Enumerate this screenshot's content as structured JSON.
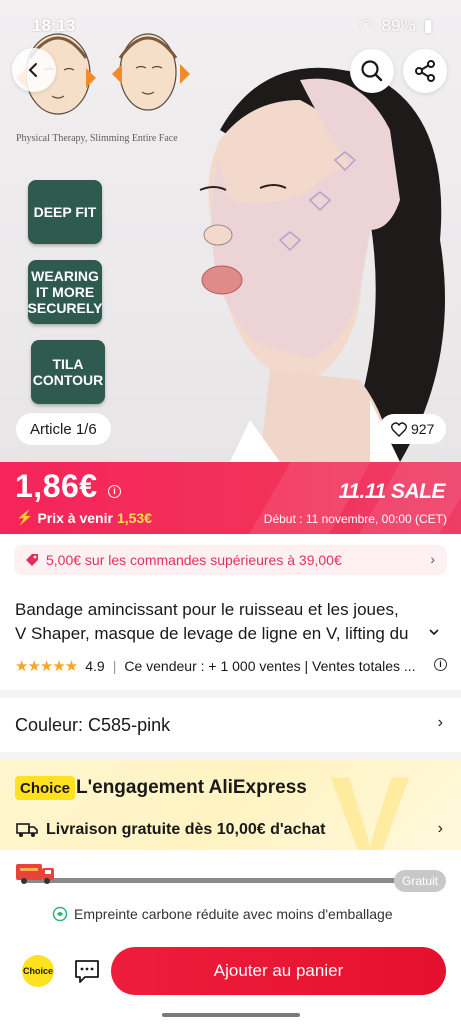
{
  "status": {
    "time": "18:13",
    "battery": "89%"
  },
  "hero": {
    "caption": "Physical Therapy, Slimming Entire Face",
    "tags": [
      "DEEP FIT",
      "WEARING IT MORE SECURELY",
      "TILA CONTOUR"
    ],
    "article": "Article 1/6",
    "likes": "927"
  },
  "price": {
    "current": "1,86€",
    "future_label": "Prix à venir",
    "future_value": "1,53€",
    "sale": "11.11 SALE",
    "sale_date": "Début : 11 novembre, 00:00 (CET)"
  },
  "coupon": {
    "text": "5,00€ sur les commandes supérieures à 39,00€"
  },
  "product": {
    "title_line1": "Bandage amincissant pour le ruisseau et les joues,",
    "title_line2": "V Shaper, masque de levage de ligne en V, lifting du",
    "rating": "4.9",
    "seller_info": "Ce vendeur : + 1 000 ventes | Ventes totales ..."
  },
  "color": {
    "label": "Couleur: C585-pink"
  },
  "choice": {
    "badge": "Choice",
    "title": "L'engagement AliExpress",
    "delivery": "Livraison gratuite dès 10,00€ d'achat",
    "free_label": "Gratuit",
    "progress": 0.0
  },
  "eco": {
    "text": "Empreinte carbone réduite avec moins d'emballage"
  },
  "bottom": {
    "choice_label": "Choice",
    "cart_button": "Ajouter au panier"
  },
  "colors": {
    "brand": "#e5102e",
    "price_banner": "#f5245a",
    "choice_yellow": "#ffe11f",
    "tag_green": "#2f5a4f"
  }
}
